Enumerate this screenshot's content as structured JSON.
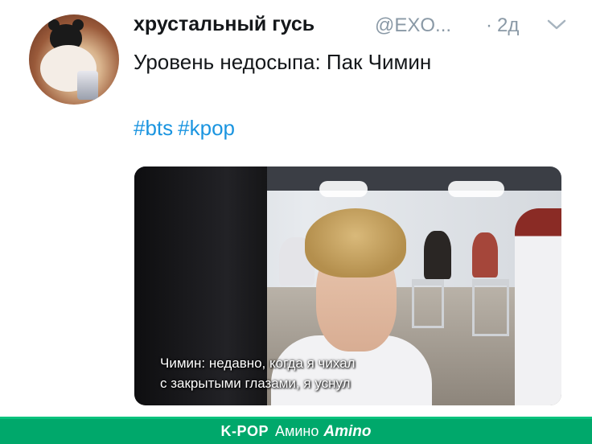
{
  "tweet": {
    "author_name": "хрустальный гусь",
    "handle": "@EXO...",
    "dot": "·",
    "time": "2д",
    "text": "Уровень недосыпа: Пак Чимин",
    "hashtags": [
      "#bts",
      "#kpop"
    ],
    "icons": {
      "avatar": "profile-avatar",
      "menu": "chevron-down-icon"
    }
  },
  "media": {
    "caption_line1": "Чимин: недавно, когда я чихал",
    "caption_line2": "с закрытыми глазами, я уснул"
  },
  "footer": {
    "brand": "K-POP",
    "word": "Амино",
    "logo": "Amino",
    "color": "#00a86b"
  }
}
